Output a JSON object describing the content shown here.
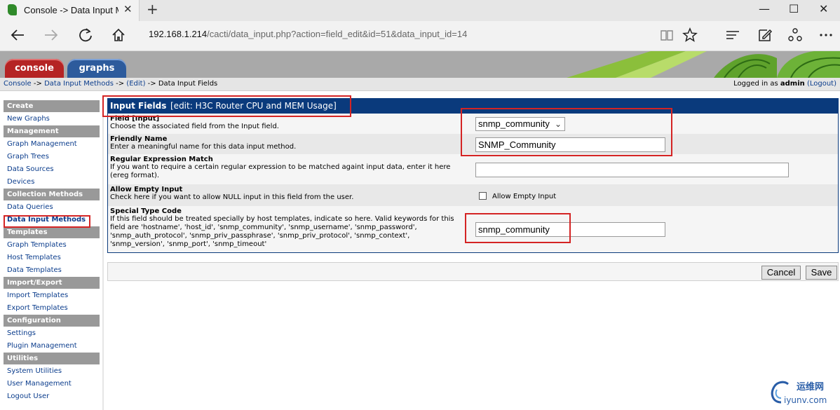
{
  "browser": {
    "tab_title": "Console -> Data Input M",
    "tab_close": "✕",
    "new_tab": "+",
    "url_host": "192.168.1.214",
    "url_path": "/cacti/data_input.php?action=field_edit&id=51&data_input_id=14",
    "window_controls": [
      "—",
      "☐",
      "✕"
    ]
  },
  "header": {
    "tabs": [
      {
        "label": "console",
        "color": "#b52424"
      },
      {
        "label": "graphs",
        "color": "#2d5b9c"
      }
    ]
  },
  "breadcrumb": {
    "items": [
      "Console",
      "Data Input Methods",
      "(Edit)"
    ],
    "separator": "->",
    "current": "Data Input Fields"
  },
  "login": {
    "prefix": "Logged in as",
    "user": "admin",
    "logout": "(Logout)"
  },
  "sidebar": {
    "create_header": "Create",
    "new_graphs": "New Graphs",
    "management_header": "Management",
    "graph_management": "Graph Management",
    "graph_trees": "Graph Trees",
    "data_sources": "Data Sources",
    "devices": "Devices",
    "collection_header": "Collection Methods",
    "data_queries": "Data Queries",
    "data_input_methods": "Data Input Methods",
    "templates_header": "Templates",
    "graph_templates": "Graph Templates",
    "host_templates": "Host Templates",
    "data_templates": "Data Templates",
    "import_export_header": "Import/Export",
    "import_templates": "Import Templates",
    "export_templates": "Export Templates",
    "configuration_header": "Configuration",
    "settings": "Settings",
    "plugin_management": "Plugin Management",
    "utilities_header": "Utilities",
    "system_utilities": "System Utilities",
    "user_management": "User Management",
    "logout_user": "Logout User"
  },
  "panel": {
    "title": "Input Fields",
    "subtitle": "[edit: H3C Router CPU and MEM Usage]",
    "fields": {
      "field": {
        "label": "Field [Input]",
        "description": "Choose the associated field from the Input field.",
        "value": "snmp_community"
      },
      "friendly_name": {
        "label": "Friendly Name",
        "description": "Enter a meaningful name for this data input method.",
        "value": "SNMP_Community"
      },
      "regex": {
        "label": "Regular Expression Match",
        "description": "If you want to require a certain regular expression to be matched againt input data, enter it here (ereg format).",
        "value": ""
      },
      "allow_empty": {
        "label": "Allow Empty Input",
        "description": "Check here if you want to allow NULL input in this field from the user.",
        "checkbox_label": "Allow Empty Input",
        "checked": false
      },
      "special_type": {
        "label": "Special Type Code",
        "description": "If this field should be treated specially by host templates, indicate so here. Valid keywords for this field are 'hostname', 'host_id', 'snmp_community', 'snmp_username', 'snmp_password', 'snmp_auth_protocol', 'snmp_priv_passphrase', 'snmp_priv_protocol', 'snmp_context', 'snmp_version', 'snmp_port', 'snmp_timeout'",
        "value": "snmp_community"
      }
    }
  },
  "actions": {
    "cancel": "Cancel",
    "save": "Save"
  },
  "watermark": {
    "text1": "运维网",
    "text2": "iyunv.com"
  },
  "highlight_color": "#d42424"
}
